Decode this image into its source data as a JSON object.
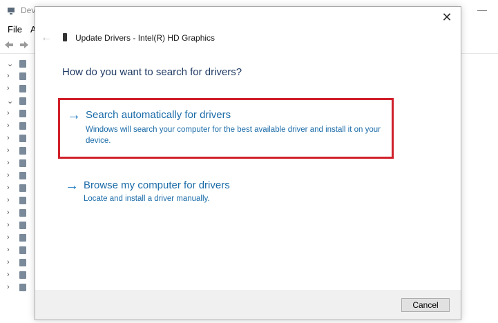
{
  "background_window": {
    "title": "Dev",
    "menu": [
      "File",
      "A"
    ],
    "controls": {
      "minimize": "—",
      "maximize": "☐"
    },
    "tree_rows": [
      {
        "chevron": "⌄"
      },
      {
        "chevron": "›"
      },
      {
        "chevron": "›"
      },
      {
        "chevron": "⌄"
      },
      {
        "chevron": "›"
      },
      {
        "chevron": "›"
      },
      {
        "chevron": "›"
      },
      {
        "chevron": "›"
      },
      {
        "chevron": "›"
      },
      {
        "chevron": "›"
      },
      {
        "chevron": "›"
      },
      {
        "chevron": "›"
      },
      {
        "chevron": "›"
      },
      {
        "chevron": "›"
      },
      {
        "chevron": "›"
      },
      {
        "chevron": "›"
      },
      {
        "chevron": "›"
      },
      {
        "chevron": "›"
      },
      {
        "chevron": "›"
      }
    ]
  },
  "dialog": {
    "close_glyph": "✕",
    "back_glyph": "←",
    "title": "Update Drivers - Intel(R) HD Graphics",
    "heading": "How do you want to search for drivers?",
    "options": [
      {
        "arrow": "→",
        "title": "Search automatically for drivers",
        "description": "Windows will search your computer for the best available driver and install it on your device."
      },
      {
        "arrow": "→",
        "title": "Browse my computer for drivers",
        "description": "Locate and install a driver manually."
      }
    ],
    "cancel_label": "Cancel"
  },
  "colors": {
    "highlight_border": "#d0202a",
    "link": "#1a6ba8",
    "heading": "#1f3a63",
    "footer": "#f0f0f0"
  },
  "icons": {
    "back": "back-arrow-icon",
    "close": "close-icon",
    "device": "display-adapter-icon",
    "option_arrow": "arrow-right-icon"
  }
}
